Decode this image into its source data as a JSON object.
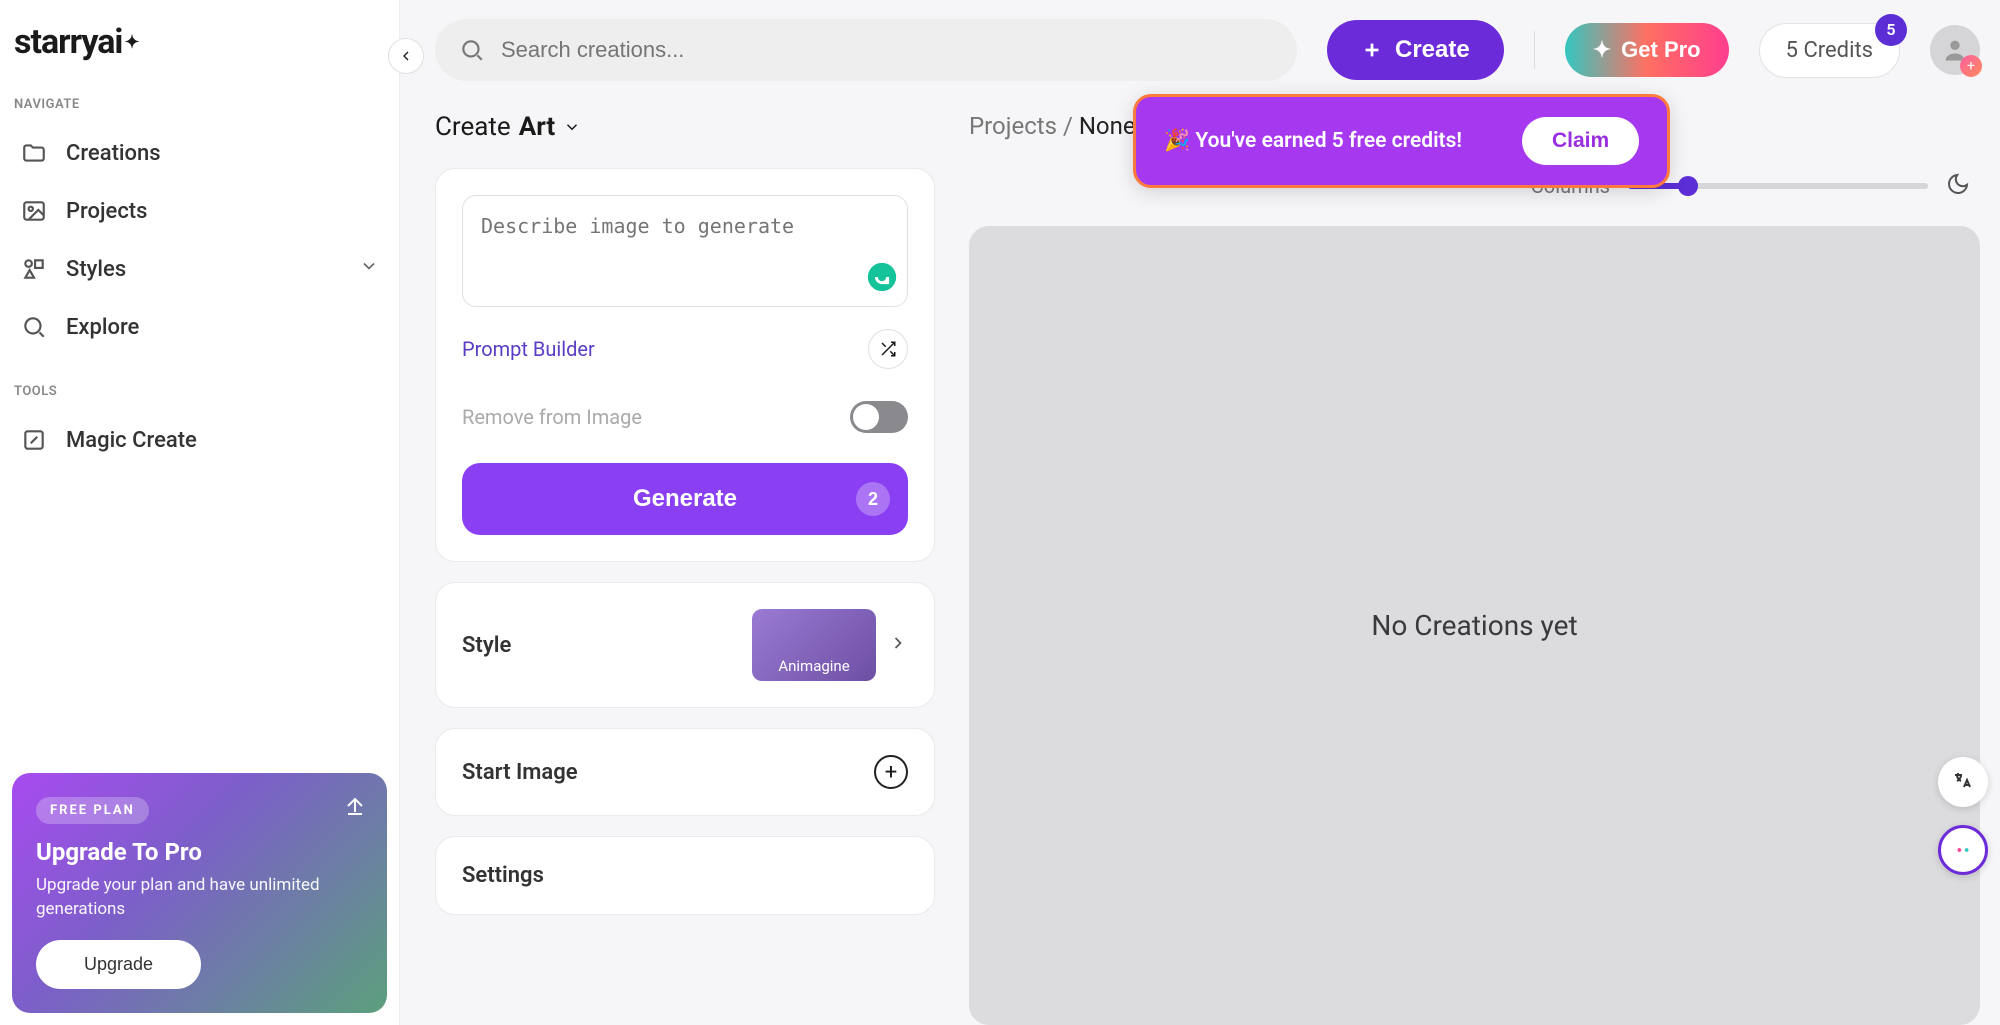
{
  "brand": "starryai",
  "sidebar": {
    "navigate_label": "NAVIGATE",
    "tools_label": "TOOLS",
    "items": {
      "creations": "Creations",
      "projects": "Projects",
      "styles": "Styles",
      "explore": "Explore",
      "magic_create": "Magic Create"
    }
  },
  "upgrade": {
    "plan_badge": "FREE PLAN",
    "title": "Upgrade To Pro",
    "desc": "Upgrade your plan and have unlimited generations",
    "button": "Upgrade"
  },
  "header": {
    "search_placeholder": "Search creations...",
    "create": "Create",
    "get_pro": "Get Pro",
    "credits": "5 Credits",
    "credits_badge": "5"
  },
  "create_panel": {
    "heading_pre": "Create",
    "heading_bold": "Art",
    "prompt_placeholder": "Describe image to generate",
    "prompt_builder": "Prompt Builder",
    "remove_label": "Remove from Image",
    "generate": "Generate",
    "generate_cost": "2",
    "style_label": "Style",
    "style_name": "Animagine",
    "start_image": "Start Image",
    "settings": "Settings"
  },
  "right": {
    "breadcrumb_root": "Projects",
    "breadcrumb_sep": " / ",
    "breadcrumb_current": "None",
    "columns_label": "Columns",
    "empty_text": "No Creations yet"
  },
  "toast": {
    "text": "🎉 You've earned 5 free credits!",
    "claim": "Claim"
  }
}
